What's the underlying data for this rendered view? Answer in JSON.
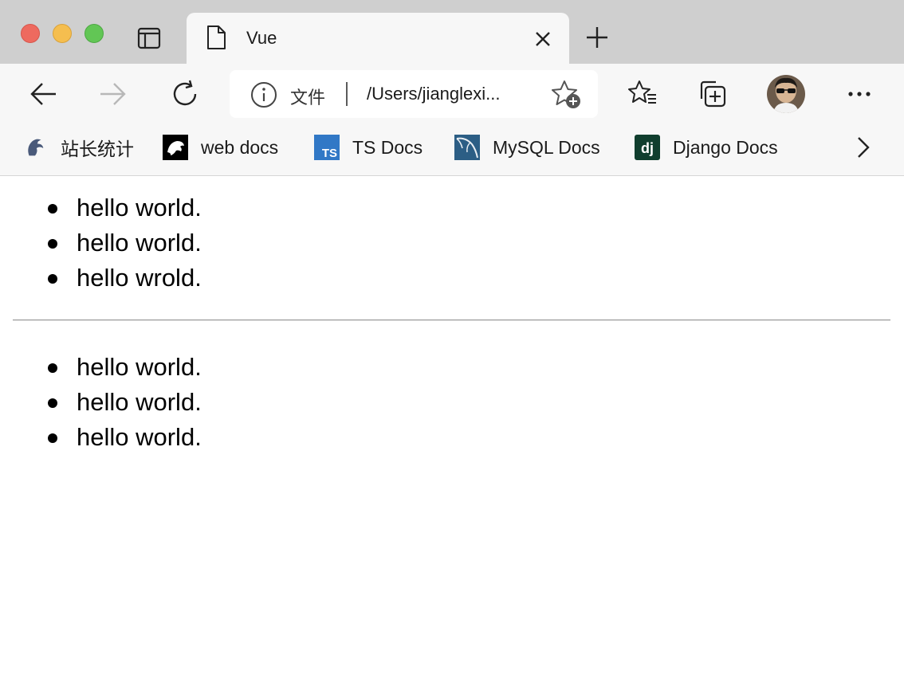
{
  "tab": {
    "title": "Vue"
  },
  "address_bar": {
    "label": "文件",
    "url": "/Users/jianglexi..."
  },
  "bookmarks": [
    {
      "label": "站长统计"
    },
    {
      "label": "web docs"
    },
    {
      "label": "TS Docs",
      "icon_text": "TS"
    },
    {
      "label": "MySQL Docs"
    },
    {
      "label": "Django Docs",
      "icon_text": "dj"
    }
  ],
  "page": {
    "list_top": [
      "hello world.",
      "hello world.",
      "hello wrold."
    ],
    "list_bottom": [
      "hello world.",
      "hello world.",
      "hello world."
    ]
  },
  "colors": {
    "close": "#ee6a5f",
    "minimize": "#f5be4f",
    "maximize": "#62c655",
    "ts_blue": "#3178c6",
    "mysql_blue": "#2c5e85",
    "django_green": "#103e2e"
  },
  "icons": [
    "tab-actions-icon",
    "page-icon",
    "close-icon",
    "plus-icon",
    "back-arrow-icon",
    "forward-arrow-icon",
    "refresh-icon",
    "info-icon",
    "add-favorite-icon",
    "favorites-icon",
    "collections-icon",
    "more-icon",
    "chevron-right-icon"
  ]
}
